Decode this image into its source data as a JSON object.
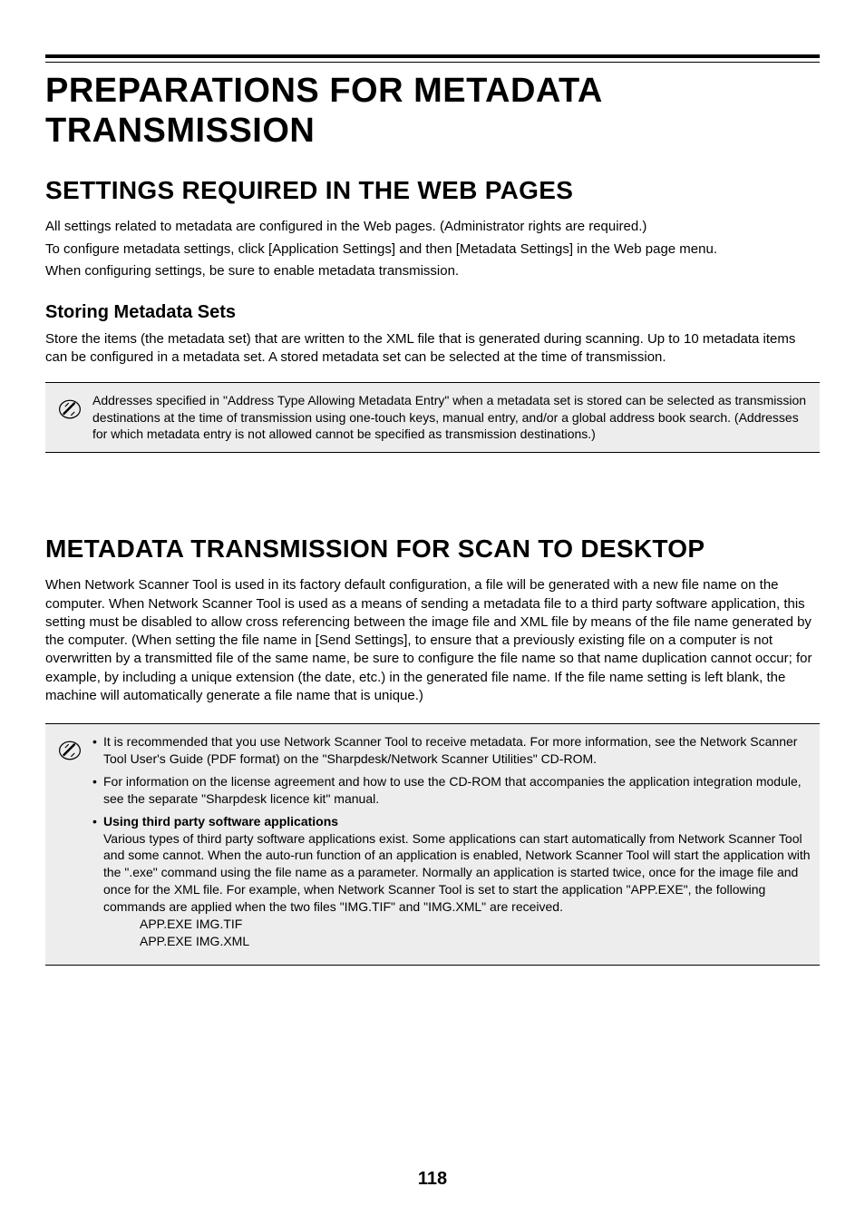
{
  "chapter_title": "PREPARATIONS FOR METADATA TRANSMISSION",
  "section1": {
    "title": "SETTINGS REQUIRED IN THE WEB PAGES",
    "p1": "All settings related to metadata are configured in the Web pages. (Administrator rights are required.)",
    "p2": "To configure metadata settings, click [Application Settings] and then [Metadata Settings] in the Web page menu.",
    "p3": "When configuring settings, be sure to enable metadata transmission.",
    "sub_title": "Storing Metadata Sets",
    "sub_p": "Store the items (the metadata set) that are written to the XML file that is generated during scanning. Up to 10 metadata items can be configured in a metadata set. A stored metadata set can be selected at the time of transmission.",
    "note": "Addresses specified in \"Address Type Allowing Metadata Entry\" when a metadata set is stored can be selected as transmission destinations at the time of transmission using one-touch keys, manual entry, and/or a global address book search. (Addresses for which metadata entry is not allowed cannot be specified as transmission destinations.)"
  },
  "section2": {
    "title": "METADATA TRANSMISSION FOR SCAN TO DESKTOP",
    "p1": "When Network Scanner Tool is used in its factory default configuration, a file will be generated with a new file name on the computer. When Network Scanner Tool is used as a means of sending a metadata file to a third party software application, this setting must be disabled to allow cross referencing between the image file and XML file by means of the file name generated by the computer. (When setting the file name in [Send Settings], to ensure that a previously existing file on a computer is not overwritten by a transmitted file of the same name, be sure to configure the file name so that name duplication cannot occur; for example, by including a unique extension (the date, etc.) in the generated file name. If the file name setting is left blank, the machine will automatically generate a file name that is unique.)",
    "note_bullets": [
      {
        "lead": "",
        "text": "It is recommended that you use Network Scanner Tool to receive metadata. For more information, see the Network Scanner Tool User's Guide (PDF format) on the \"Sharpdesk/Network Scanner Utilities\" CD-ROM."
      },
      {
        "lead": "",
        "text": "For information on the license agreement and how to use the CD-ROM that accompanies the application integration module, see the separate \"Sharpdesk licence kit\" manual."
      },
      {
        "lead": "Using third party software applications",
        "text": "Various types of third party software applications exist. Some applications can start automatically from Network Scanner Tool and some cannot. When the auto-run function of an application is enabled, Network Scanner Tool will start the application with the \".exe\" command using the file name as a parameter. Normally an application is started twice, once for the image file and once for the XML file. For example, when Network Scanner Tool is set to start the application \"APP.EXE\", the following commands are applied when the two files \"IMG.TIF\" and \"IMG.XML\" are received."
      }
    ],
    "cmd1": "APP.EXE IMG.TIF",
    "cmd2": "APP.EXE IMG.XML"
  },
  "page_number": "118"
}
